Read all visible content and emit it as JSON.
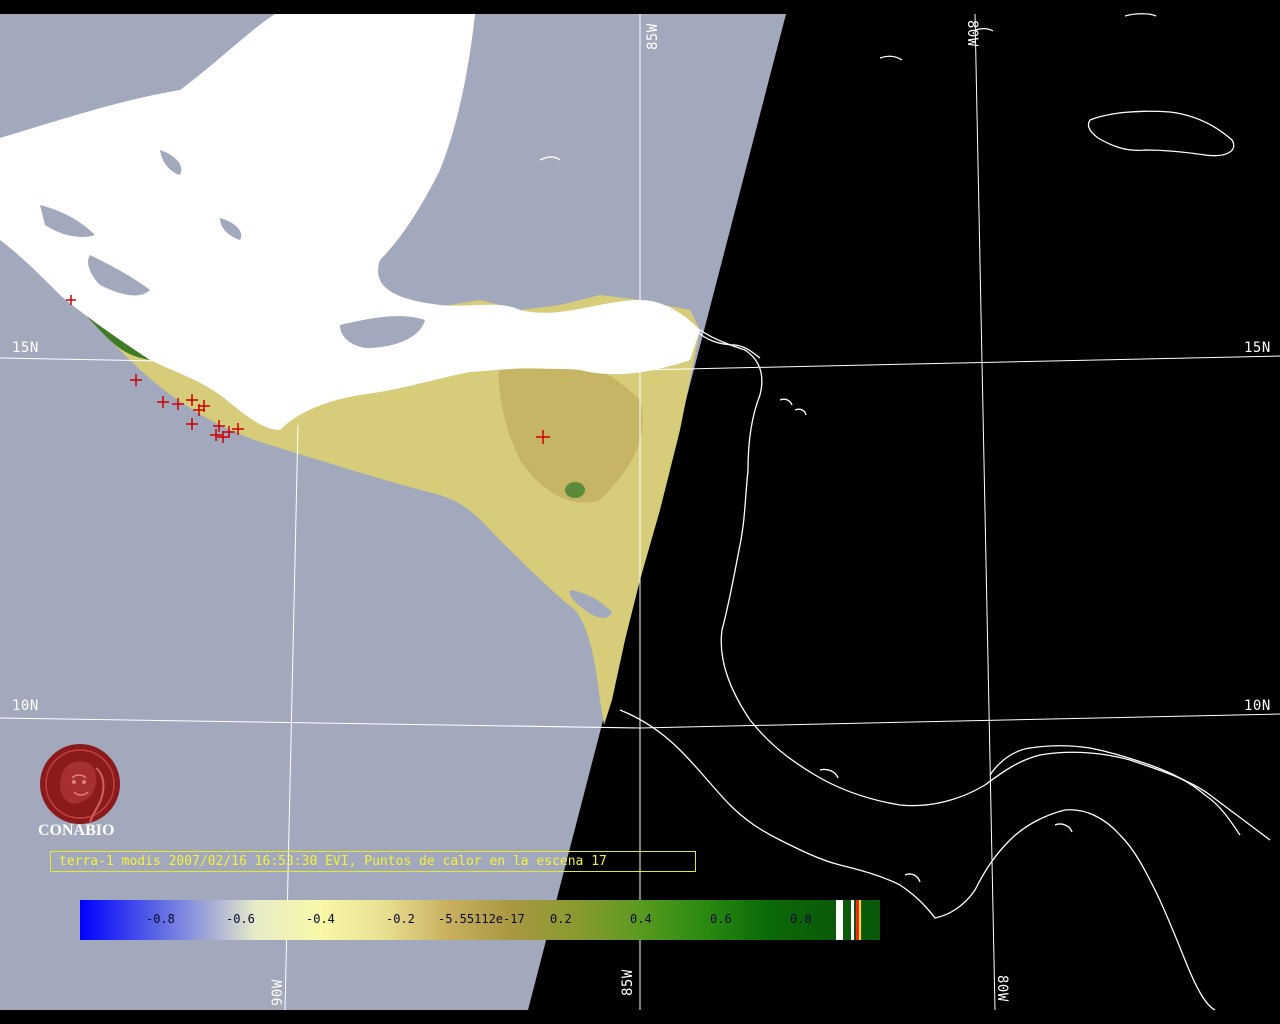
{
  "map": {
    "lat_labels_left": [
      "15N",
      "10N"
    ],
    "lat_labels_right": [
      "15N",
      "10N"
    ],
    "lon_labels_top": [
      "85W",
      "80W"
    ],
    "lon_labels_bottom": [
      "90W",
      "85W",
      "80W"
    ]
  },
  "logo": {
    "text": "CONABIO",
    "color": "#8b1a1a"
  },
  "caption": "terra-1 modis 2007/02/16 16:53:30 EVI, Puntos de calor en la escena 17",
  "colorbar": {
    "ticks": [
      "-0.8",
      "-0.6",
      "-0.4",
      "-0.2",
      "-5.55112e-17",
      "0.2",
      "0.4",
      "0.6",
      "0.8"
    ]
  },
  "hotspots": {
    "color": "#cc0000",
    "count": 17
  },
  "colors": {
    "ocean": "#a3a9bd",
    "cloud": "#ffffff",
    "vegetation": "#d8cc78",
    "night": "#000000",
    "grid": "#ffffff",
    "caption": "#f2f23a"
  }
}
